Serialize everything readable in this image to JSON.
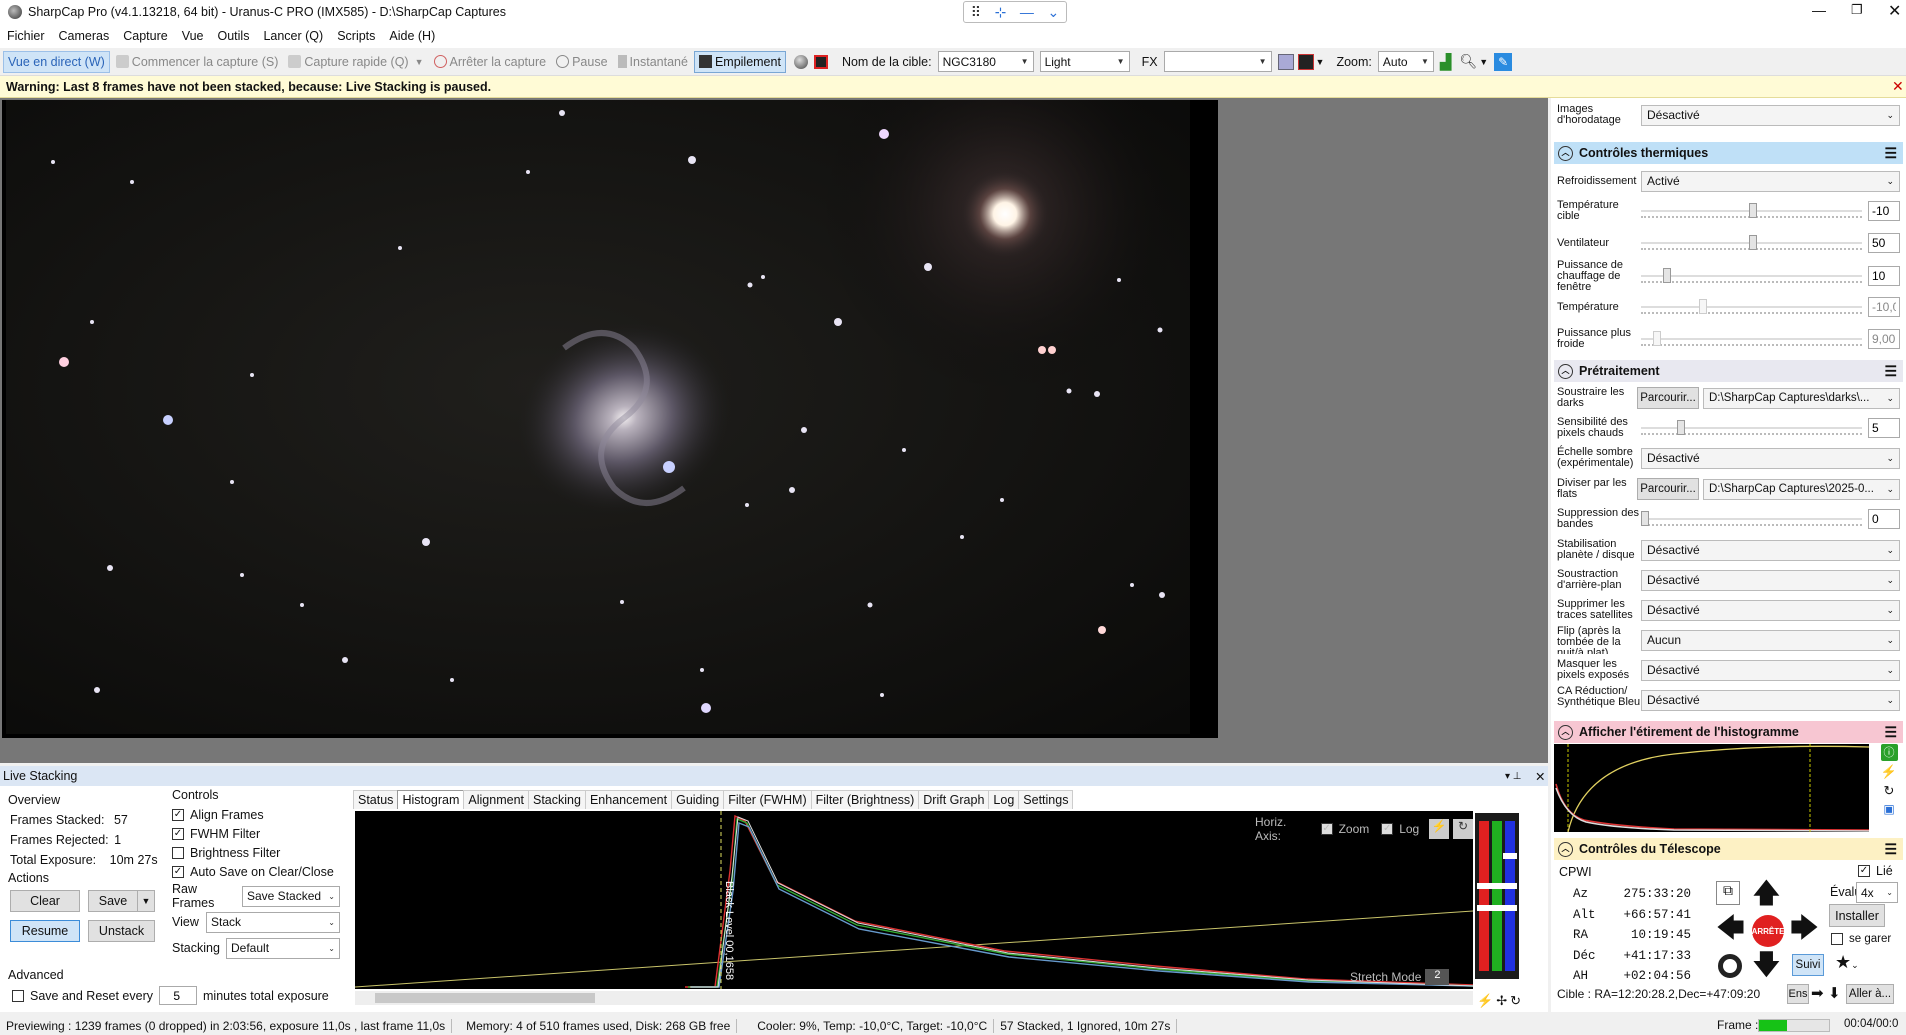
{
  "window": {
    "title": "SharpCap Pro (v4.1.13218, 64 bit) - Uranus-C PRO (IMX585) - D:\\SharpCap Captures"
  },
  "menu": [
    "Fichier",
    "Cameras",
    "Capture",
    "Vue",
    "Outils",
    "Lancer (Q)",
    "Scripts",
    "Aide (H)"
  ],
  "toolbar": {
    "live_view": "Vue en direct (W)",
    "start_capture": "Commencer la capture (S)",
    "quick_capture": "Capture rapide (Q)",
    "stop_capture": "Arrêter la capture",
    "pause": "Pause",
    "snapshot": "Instantané",
    "stacking": "Empilement",
    "target_label": "Nom de la cible:",
    "target_value": "NGC3180",
    "frame_type": "Light",
    "fx_label": "FX",
    "fx_value": "",
    "zoom_label": "Zoom:",
    "zoom_value": "Auto"
  },
  "warning": "Warning: Last 8 frames have not been stacked, because: Live Stacking is paused.",
  "panel": {
    "timestamp_label": "Images d'horodatage",
    "timestamp_value": "Désactivé",
    "thermal": {
      "title": "Contrôles thermiques",
      "cooling_label": "Refroidissement",
      "cooling_value": "Activé",
      "target_temp_label": "Température cible",
      "target_temp_value": "-10",
      "fan_label": "Ventilateur",
      "fan_value": "50",
      "heater_label": "Puissance de chauffage de fenêtre",
      "heater_value": "10",
      "temp_label": "Température",
      "temp_value": "-10,0",
      "cooler_power_label": "Puissance plus froide",
      "cooler_power_value": "9,00"
    },
    "preprocessing": {
      "title": "Prétraitement",
      "darks_label": "Soustraire les darks",
      "darks_button": "Parcourir...",
      "darks_value": "D:\\SharpCap Captures\\darks\\...",
      "hotpix_label": "Sensibilité des pixels chauds",
      "hotpix_value": "5",
      "darkscale_label": "Échelle sombre (expérimentale)",
      "darkscale_value": "Désactivé",
      "flats_label": "Diviser par les flats",
      "flats_button": "Parcourir...",
      "flats_value": "D:\\SharpCap Captures\\2025-0...",
      "banding_label": "Suppression des bandes",
      "banding_value": "0",
      "stabil_label": "Stabilisation planète / disque",
      "stabil_value": "Désactivé",
      "bg_label": "Soustraction d'arrière-plan",
      "bg_value": "Désactivé",
      "sat_label": "Supprimer les traces satellites",
      "sat_value": "Désactivé",
      "flip_label": "Flip (après la tombée de la nuit/à plat)",
      "flip_value": "Aucun",
      "mask_label": "Masquer les pixels exposés",
      "mask_value": "Désactivé",
      "ca_label": "CA Réduction/ Synthétique Bleu",
      "ca_value": "Désactivé"
    },
    "histogram_title": "Afficher l'étirement de l'histogramme",
    "telescope": {
      "title": "Contrôles du Télescope",
      "mount": "CPWI",
      "linked_label": "Lié",
      "az_label": "Az",
      "az_value": "275:33:20",
      "alt_label": "Alt",
      "alt_value": "+66:57:41",
      "ra_label": "RA",
      "ra_value": "10:19:45",
      "dec_label": "Déc",
      "dec_value": "+41:17:33",
      "ah_label": "AH",
      "ah_value": "+02:04:56",
      "rate_label": "Évaluer:",
      "rate_value": "4x",
      "install_button": "Installer",
      "stop_button": "ARRÊTE",
      "park_label": "se garer",
      "track_button": "Suivi",
      "target": "Cible : RA=12:20:28.2,Dec=+47:09:20",
      "ens_button": "Ens",
      "goto_button": "Aller à..."
    }
  },
  "live_stacking": {
    "title": "Live Stacking",
    "overview_title": "Overview",
    "frames_stacked_label": "Frames Stacked:",
    "frames_stacked": "57",
    "frames_rejected_label": "Frames Rejected:",
    "frames_rejected": "1",
    "total_exposure_label": "Total Exposure:",
    "total_exposure": "10m 27s",
    "actions_title": "Actions",
    "clear": "Clear",
    "save": "Save",
    "resume": "Resume",
    "unstack": "Unstack",
    "advanced_title": "Advanced",
    "save_reset_label": "Save and Reset every",
    "save_reset_value": "5",
    "save_reset_suffix": "minutes total exposure",
    "controls_title": "Controls",
    "align_frames": "Align Frames",
    "fwhm_filter": "FWHM Filter",
    "brightness_filter": "Brightness Filter",
    "auto_save": "Auto Save on Clear/Close",
    "raw_frames_label": "Raw Frames",
    "raw_frames_value": "Save Stacked",
    "view_label": "View",
    "view_value": "Stack",
    "stacking_label": "Stacking",
    "stacking_value": "Default",
    "tabs": [
      "Status",
      "Histogram",
      "Alignment",
      "Stacking",
      "Enhancement",
      "Guiding",
      "Filter (FWHM)",
      "Filter (Brightness)",
      "Drift Graph",
      "Log",
      "Settings"
    ],
    "horiz_axis_label": "Horiz. Axis:",
    "zoom_label": "Zoom",
    "log_label": "Log",
    "black_level_label": "Black Level 00,1658",
    "stretch_mode_label": "Stretch Mode",
    "stretch_mode_value": "2"
  },
  "status": {
    "preview": "Previewing : 1239 frames (0 dropped) in 2:03:56, exposure 11,0s , last frame 11,0s",
    "memory": "Memory: 4 of 510 frames used, Disk: 268 GB free",
    "cooler": "Cooler: 9%, Temp: -10,0°C, Target: -10,0°C",
    "stacked": "57 Stacked, 1 Ignored, 10m 27s",
    "frame_label": "Frame :",
    "frame_time": "00:04/00:0"
  },
  "colors": {
    "accent": "#1e90ff",
    "warning_bg": "#fffbd6",
    "section_blue": "#bfe0f7",
    "section_pink": "#f7c6d2",
    "section_yellow": "#fdf1c4"
  }
}
